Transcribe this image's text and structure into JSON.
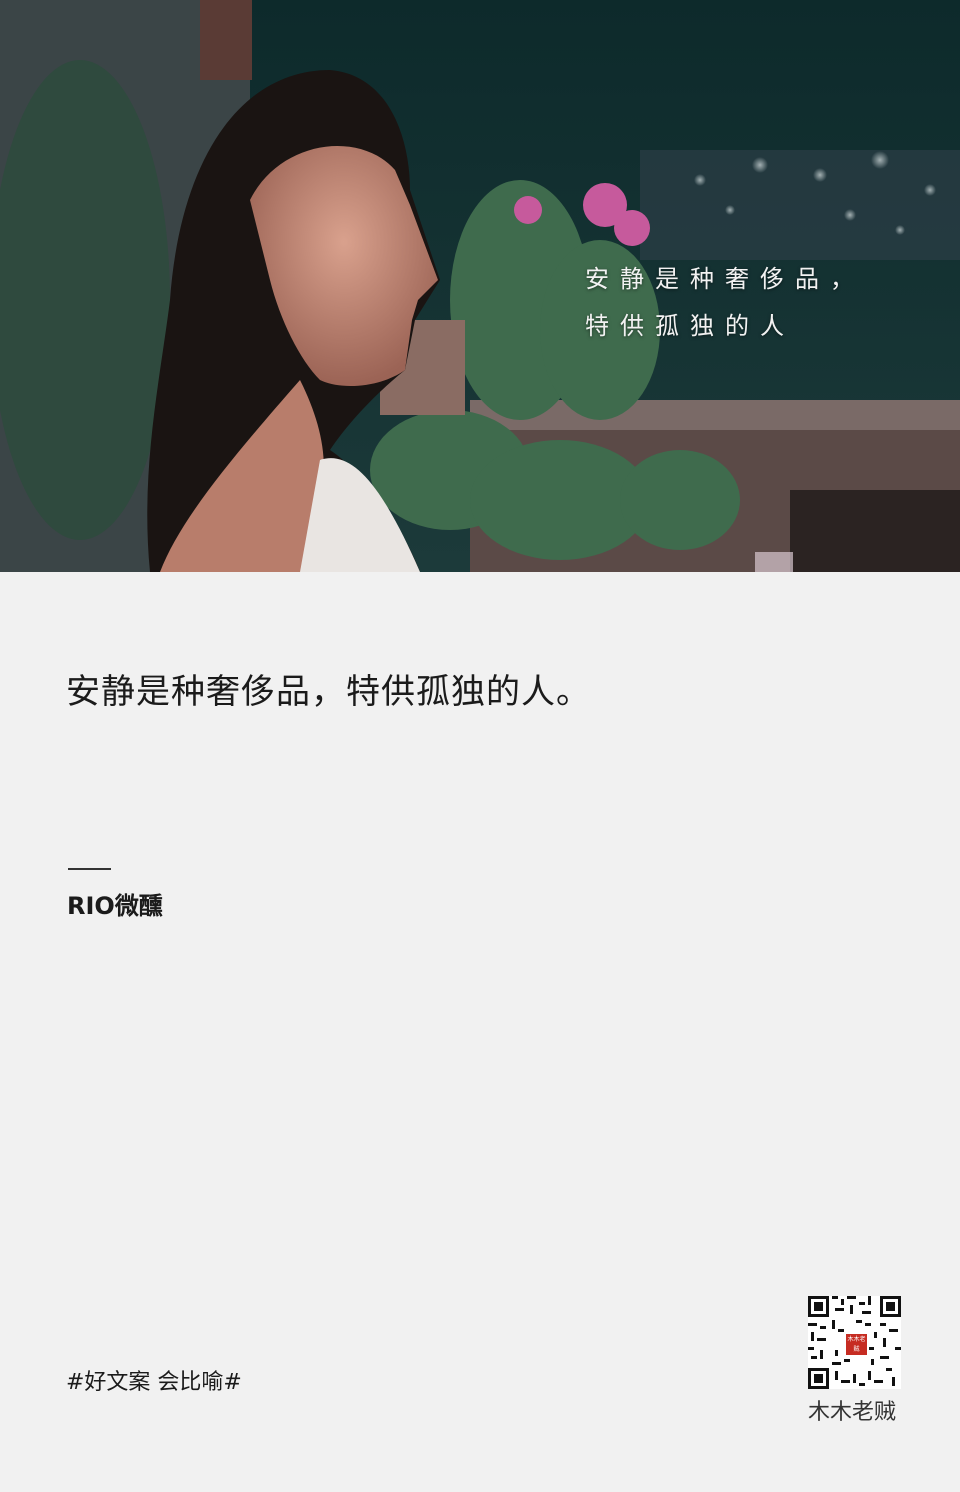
{
  "photo": {
    "overlay_line1": "安静是种奢侈品，",
    "overlay_line2": "特供孤独的人"
  },
  "quote": "安静是种奢侈品，特供孤独的人。",
  "brand": "RIO微醺",
  "hashtag": "#好文案 会比喻#",
  "qr": {
    "logo_text": "木木老贼"
  },
  "author": "木木老贼",
  "colors": {
    "background": "#f1f1f1",
    "text": "#1b1b1b",
    "seal": "#c62c22"
  }
}
